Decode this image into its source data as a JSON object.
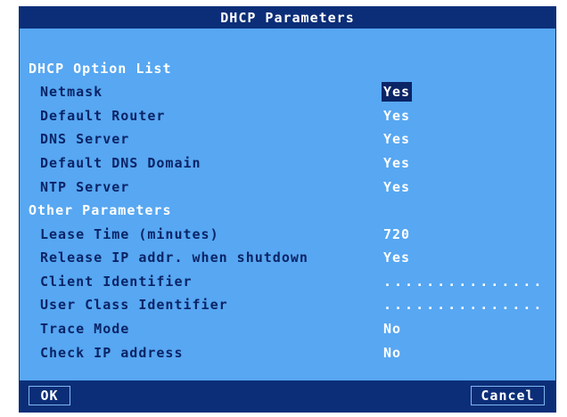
{
  "dialog": {
    "title": "DHCP Parameters"
  },
  "sections": {
    "option_list": "DHCP Option List",
    "other_parameters": "Other Parameters"
  },
  "options": [
    {
      "label": "Netmask",
      "value": "Yes",
      "selected": true
    },
    {
      "label": "Default Router",
      "value": "Yes"
    },
    {
      "label": "DNS Server",
      "value": "Yes"
    },
    {
      "label": "Default DNS Domain",
      "value": "Yes"
    },
    {
      "label": "NTP Server",
      "value": "Yes"
    }
  ],
  "parameters": [
    {
      "label": "Lease Time (minutes)",
      "value": "720"
    },
    {
      "label": "Release IP addr. when shutdown",
      "value": "Yes"
    },
    {
      "label": "Client Identifier",
      "value": "..............."
    },
    {
      "label": "User Class Identifier",
      "value": "..............."
    },
    {
      "label": "Trace Mode",
      "value": "No"
    },
    {
      "label": "Check IP address",
      "value": "No"
    }
  ],
  "buttons": {
    "ok": "OK",
    "cancel": "Cancel"
  },
  "colors": {
    "dialog_background": "#57a7f2",
    "title_bar": "#0c2e78",
    "label_text": "#0a2466",
    "value_text": "#ffffff"
  }
}
